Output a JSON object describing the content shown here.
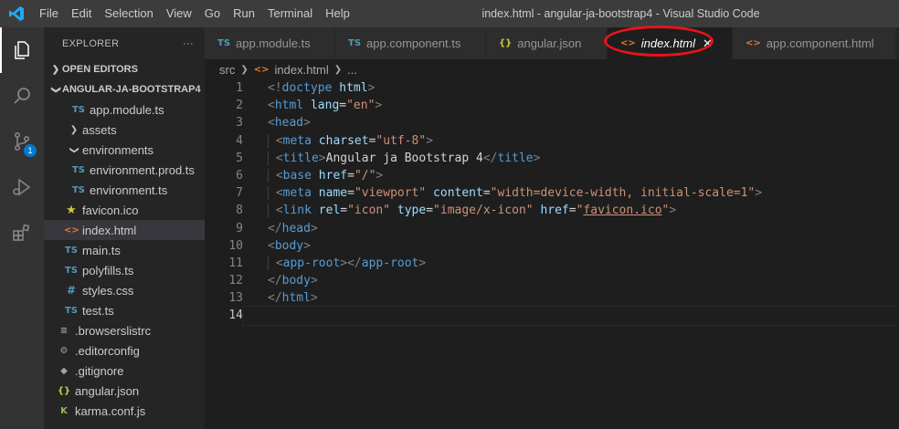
{
  "window": {
    "title": "index.html - angular-ja-bootstrap4 - Visual Studio Code",
    "menu": [
      "File",
      "Edit",
      "Selection",
      "View",
      "Go",
      "Run",
      "Terminal",
      "Help"
    ]
  },
  "activity_bar": {
    "items": [
      "explorer-icon",
      "search-icon",
      "source-control-icon",
      "run-debug-icon",
      "extensions-icon"
    ],
    "scm_badge": "1"
  },
  "sidebar": {
    "header": "EXPLORER",
    "more": "···",
    "open_editors": "OPEN EDITORS",
    "project": "ANGULAR-JA-BOOTSTRAP4",
    "files": [
      {
        "name": "app.module.ts",
        "icon": "TS"
      },
      {
        "name": "assets",
        "icon": ">"
      },
      {
        "name": "environments",
        "icon": "v"
      },
      {
        "name": "environment.prod.ts",
        "icon": "TS"
      },
      {
        "name": "environment.ts",
        "icon": "TS"
      },
      {
        "name": "favicon.ico",
        "icon": "★"
      },
      {
        "name": "index.html",
        "icon": "<>"
      },
      {
        "name": "main.ts",
        "icon": "TS"
      },
      {
        "name": "polyfills.ts",
        "icon": "TS"
      },
      {
        "name": "styles.css",
        "icon": "#"
      },
      {
        "name": "test.ts",
        "icon": "TS"
      },
      {
        "name": ".browserslistrc",
        "icon": "≡"
      },
      {
        "name": ".editorconfig",
        "icon": "⚙"
      },
      {
        "name": ".gitignore",
        "icon": "◆"
      },
      {
        "name": "angular.json",
        "icon": "{}"
      },
      {
        "name": "karma.conf.js",
        "icon": "K"
      }
    ]
  },
  "tabs": [
    {
      "label": "app.module.ts",
      "icon": "TS"
    },
    {
      "label": "app.component.ts",
      "icon": "TS"
    },
    {
      "label": "angular.json",
      "icon": "{}"
    },
    {
      "label": "index.html",
      "icon": "<>",
      "close": "✕"
    },
    {
      "label": "app.component.html",
      "icon": "<>"
    }
  ],
  "breadcrumb": {
    "folder": "src",
    "file": "index.html",
    "rest": "..."
  },
  "editor": {
    "line_numbers": [
      "1",
      "2",
      "3",
      "4",
      "5",
      "6",
      "7",
      "8",
      "9",
      "10",
      "11",
      "12",
      "13",
      "14"
    ],
    "lines": [
      "<!doctype html>",
      "<html lang=\"en\">",
      "<head>",
      "  <meta charset=\"utf-8\">",
      "  <title>Angular ja Bootstrap 4</title>",
      "  <base href=\"/\">",
      "  <meta name=\"viewport\" content=\"width=device-width, initial-scale=1\">",
      "  <link rel=\"icon\" type=\"image/x-icon\" href=\"favicon.ico\">",
      "</head>",
      "<body>",
      "  <app-root></app-root>",
      "</body>",
      "</html>",
      ""
    ],
    "current_line": "14"
  },
  "colors": {
    "accent": "#007acc",
    "highlight_ring": "#e8141a"
  }
}
